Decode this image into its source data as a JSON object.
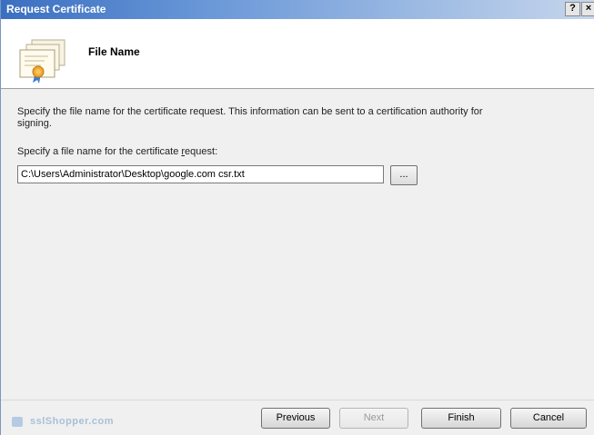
{
  "window": {
    "title": "Request Certificate",
    "help_label": "?",
    "close_label": "×"
  },
  "header": {
    "title": "File Name"
  },
  "body": {
    "description": "Specify the file name for the certificate request. This information can be sent to a certification authority for signing.",
    "field_label_pre": "Specify a file name for the certificate ",
    "field_label_accel": "r",
    "field_label_post": "equest:",
    "filename_value": "C:\\Users\\Administrator\\Desktop\\google.com csr.txt",
    "browse_label": "..."
  },
  "footer": {
    "watermark": "sslShopper.com",
    "buttons": {
      "previous": "Previous",
      "next": "Next",
      "finish": "Finish",
      "cancel": "Cancel"
    },
    "next_enabled": false
  },
  "colors": {
    "titlebar": "#3a6fc0",
    "header_bg": "#ffffff",
    "dialog_bg": "#f0f0f0"
  }
}
